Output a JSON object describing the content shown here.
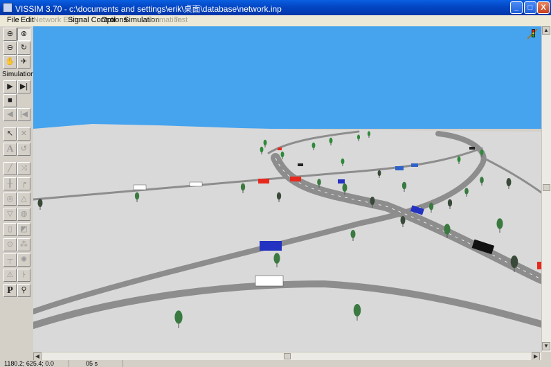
{
  "window": {
    "title": "VISSIM 3.70 - c:\\documents and settings\\erik\\桌面\\database\\network.inp",
    "minimize": "_",
    "maximize": "□",
    "close": "X"
  },
  "menu": [
    {
      "label": "File",
      "enabled": true
    },
    {
      "label": "Edit",
      "enabled": true
    },
    {
      "label": "Network Editor",
      "enabled": false
    },
    {
      "label": "Signal Control",
      "enabled": true
    },
    {
      "label": "Options",
      "enabled": true
    },
    {
      "label": "Simulation",
      "enabled": true
    },
    {
      "label": "Animation",
      "enabled": false
    },
    {
      "label": "Test",
      "enabled": false
    }
  ],
  "toolbar": {
    "simulation_label": "Simulation",
    "text_tool": "A",
    "parking_tool": "P"
  },
  "status": {
    "coords": "1180.2; 625.4; 0.0",
    "time": "05 s"
  },
  "colors": {
    "sky": "#46a3ee",
    "ground": "#d9d9d9",
    "road": "#8d8d8d"
  }
}
